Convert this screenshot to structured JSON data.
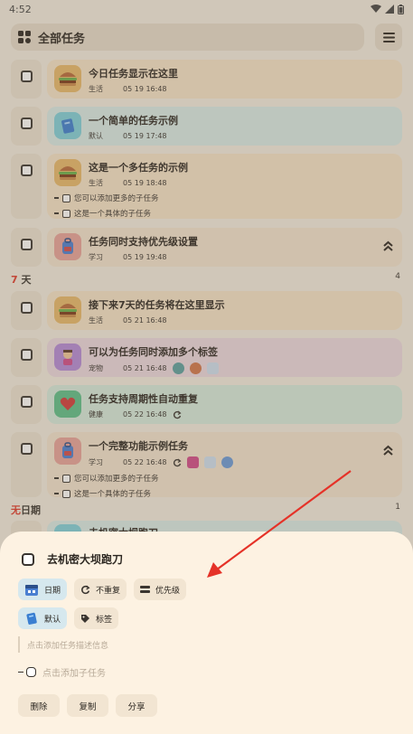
{
  "status_bar": {
    "time": "4:52"
  },
  "header": {
    "title": "全部任务"
  },
  "today_tasks": [
    {
      "title": "今日任务显示在这里",
      "tag": "生活",
      "time": "05 19 16:48",
      "color": "#f6e3c8"
    },
    {
      "title": "一个简单的任务示例",
      "tag": "默认",
      "time": "05 19 17:48",
      "color": "#d8eae6"
    },
    {
      "title": "这是一个多任务的示例",
      "tag": "生活",
      "time": "05 19 18:48",
      "color": "#f6e3c8",
      "subtasks": [
        "您可以添加更多的子任务",
        "这是一个具体的子任务"
      ]
    },
    {
      "title": "任务同时支持优先级设置",
      "tag": "学习",
      "time": "05 19 19:48",
      "color": "#f3e4cf"
    }
  ],
  "section_7days": {
    "num": "7",
    "label": " 天",
    "count": "4"
  },
  "week_tasks": [
    {
      "title": "接下来7天的任务将在这里显示",
      "tag": "生活",
      "time": "05 21 16:48",
      "color": "#f6e3c8"
    },
    {
      "title": "可以为任务同时添加多个标签",
      "tag": "宠物",
      "time": "05 21 16:48",
      "color": "#ecd8e0"
    },
    {
      "title": "任务支持周期性自动重复",
      "tag": "健康",
      "time": "05 22 16:48",
      "color": "#d6eadd"
    },
    {
      "title": "一个完整功能示例任务",
      "tag": "学习",
      "time": "05 22 16:48",
      "color": "#f3e4cf",
      "subtasks": [
        "您可以添加更多的子任务",
        "这是一个具体的子任务"
      ]
    }
  ],
  "section_nodate": {
    "first": "无",
    "rest": "日期",
    "count": "1"
  },
  "nodate_task": {
    "title": "去机密大坝跑刀"
  },
  "sheet": {
    "title": "去机密大坝跑刀",
    "chips_row1": [
      "日期",
      "不重复",
      "优先级"
    ],
    "chips_row2": [
      "默认",
      "标签"
    ],
    "desc_placeholder": "点击添加任务描述信息",
    "add_subtask": "点击添加子任务",
    "actions": [
      "删除",
      "复制",
      "分享"
    ]
  }
}
